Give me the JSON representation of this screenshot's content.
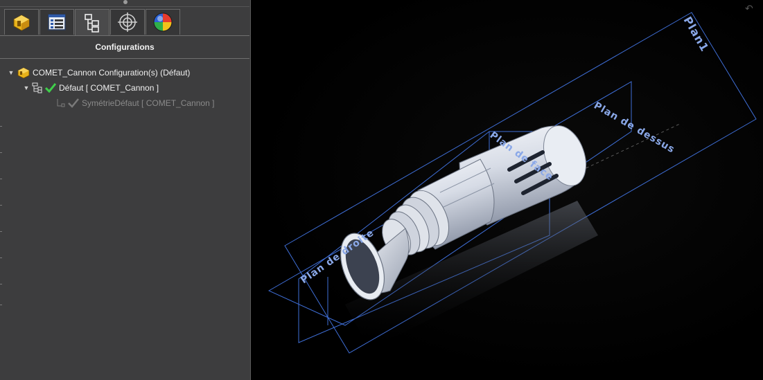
{
  "panel": {
    "title": "Configurations",
    "tabs": [
      {
        "icon": "part-icon"
      },
      {
        "icon": "property-list-icon"
      },
      {
        "icon": "configuration-tree-icon"
      },
      {
        "icon": "target-icon"
      },
      {
        "icon": "appearance-sphere-icon"
      }
    ],
    "tree": {
      "root": {
        "label": "COMET_Cannon Configuration(s)  (Défaut)"
      },
      "config": {
        "label": "Défaut [ COMET_Cannon ]"
      },
      "derived": {
        "label": "SymétrieDéfaut [ COMET_Cannon ]"
      }
    }
  },
  "viewport": {
    "planes": {
      "plan1": "Plan1",
      "dessus": "Plan de dessus",
      "face": "Plan de face",
      "droite": "Plan de droite"
    },
    "colors": {
      "plane_edge": "#3f6fd8",
      "plane_label": "#8aa8e8",
      "model": "#d8dde6"
    }
  }
}
